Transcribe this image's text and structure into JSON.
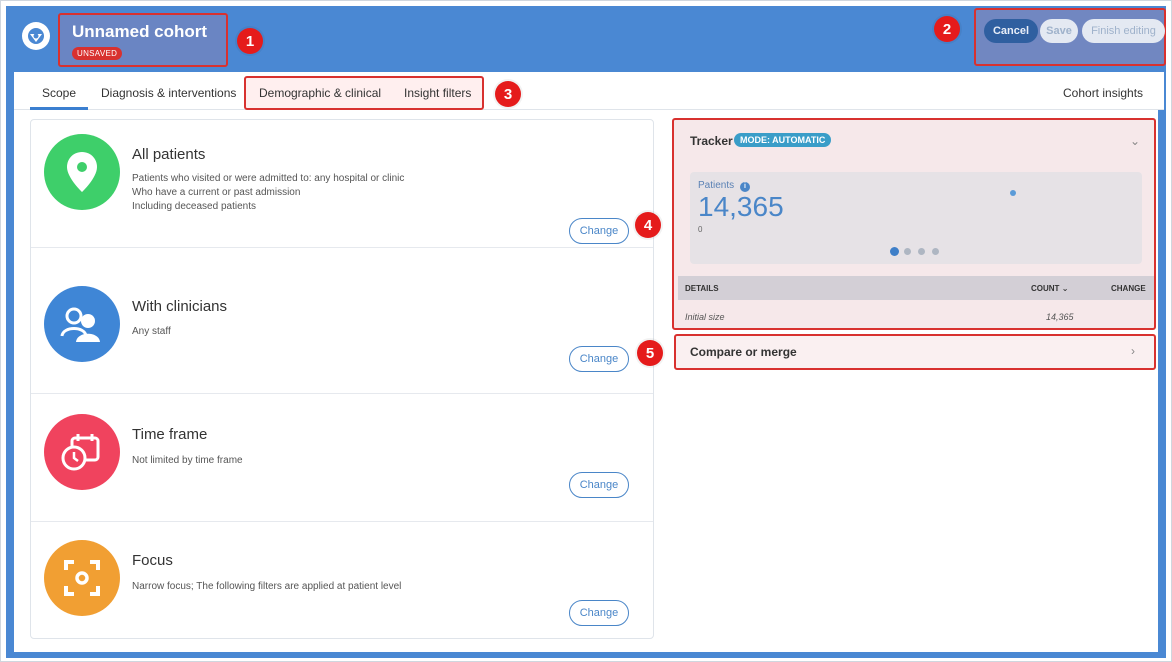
{
  "header": {
    "title": "Unnamed cohort",
    "badge": "UNSAVED",
    "cancel_label": "Cancel",
    "save_label": "Save",
    "finish_label": "Finish editing",
    "brand_color": "#4a88d3"
  },
  "tabs": [
    {
      "label": "Scope",
      "active": true
    },
    {
      "label": "Diagnosis & interventions"
    },
    {
      "label": "Demographic & clinical"
    },
    {
      "label": "Insight filters"
    },
    {
      "label": "Cohort insights"
    }
  ],
  "scope_cards": [
    {
      "title": "All patients",
      "lines": [
        "Patients who visited or were admitted to: any hospital or clinic",
        "Who have a current or past admission",
        "Including deceased patients"
      ],
      "icon": "location-pin-icon",
      "color": "#3ecf6a",
      "change_label": "Change"
    },
    {
      "title": "With clinicians",
      "lines": [
        "Any staff"
      ],
      "icon": "clinicians-icon",
      "color": "#3f86d6",
      "change_label": "Change"
    },
    {
      "title": "Time frame",
      "lines": [
        "Not limited by time frame"
      ],
      "icon": "calendar-clock-icon",
      "color": "#f0435e",
      "change_label": "Change"
    },
    {
      "title": "Focus",
      "lines": [
        "Narrow focus; The following filters are applied at patient level"
      ],
      "icon": "focus-target-icon",
      "color": "#f19f33",
      "change_label": "Change"
    }
  ],
  "tracker": {
    "title": "Tracker",
    "mode": "MODE: AUTOMATIC",
    "patients_label": "Patients",
    "patients_value": "14,365",
    "axis_min": "0",
    "details_header": "DETAILS",
    "count_header": "COUNT",
    "change_header": "CHANGE",
    "rows": [
      {
        "label": "Initial size",
        "count": "14,365",
        "change": ""
      }
    ]
  },
  "compare": {
    "label": "Compare or merge"
  },
  "annotations": [
    "1",
    "2",
    "3",
    "4",
    "5"
  ]
}
